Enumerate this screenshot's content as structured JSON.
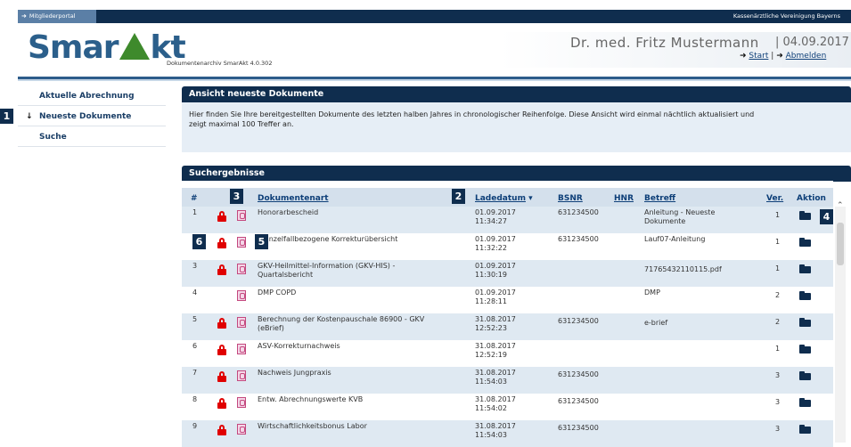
{
  "topbar": {
    "portal_label": "Mitgliederportal",
    "org_name": "Kassenärztliche Vereinigung Bayerns"
  },
  "header": {
    "logo_left": "Smar",
    "logo_right": "kt",
    "subtitle": "Dokumentenarchiv SmarAkt 4.0.302",
    "user_name": "Dr. med. Fritz Mustermann",
    "date": "| 04.09.2017",
    "start_label": "Start",
    "logout_label": "Abmelden"
  },
  "sidebar": {
    "items": [
      {
        "label": "Aktuelle Abrechnung"
      },
      {
        "label": "Neueste Dokumente",
        "mark": "↓"
      },
      {
        "label": "Suche"
      }
    ]
  },
  "badges": [
    "1",
    "2",
    "3",
    "4",
    "5",
    "6"
  ],
  "overview": {
    "title": "Ansicht neueste Dokumente",
    "text_line1": "Hier finden Sie Ihre bereitgestellten Dokumente des letzten halben Jahres in chronologischer Reihenfolge. Diese Ansicht wird einmal nächtlich aktualisiert und",
    "text_line2": "zeigt maximal 100 Treffer an."
  },
  "results": {
    "title": "Suchergebnisse",
    "columns": {
      "num": "#",
      "doctype": "Dokumentenart",
      "loaddate": "Ladedatum",
      "sort_arrow": "▾",
      "bsnr": "BSNR",
      "hnr": "HNR",
      "subject": "Betreff",
      "ver": "Ver.",
      "action": "Aktion"
    },
    "rows": [
      {
        "num": "1",
        "lock": true,
        "doctype": "Honorarbescheid",
        "doctype2": "",
        "date": "01.09.2017",
        "time": "11:34:27",
        "bsnr": "631234500",
        "subject": "Anleitung - Neueste",
        "subject2": "Dokumente",
        "ver": "1"
      },
      {
        "num": "2",
        "lock": true,
        "doctype": "- Einzelfallbezogene Korrekturübersicht",
        "doctype2": "",
        "date": "01.09.2017",
        "time": "11:32:22",
        "bsnr": "631234500",
        "subject": "Lauf07-Anleitung",
        "subject2": "",
        "ver": "1"
      },
      {
        "num": "3",
        "lock": true,
        "doctype": "GKV-Heilmittel-Information (GKV-HIS) -",
        "doctype2": "Quartalsbericht",
        "date": "01.09.2017",
        "time": "11:30:19",
        "bsnr": "",
        "subject": "71765432110115.pdf",
        "subject2": "",
        "ver": "1"
      },
      {
        "num": "4",
        "lock": false,
        "doctype": "DMP COPD",
        "doctype2": "",
        "date": "01.09.2017",
        "time": "11:28:11",
        "bsnr": "",
        "subject": "DMP",
        "subject2": "",
        "ver": "2"
      },
      {
        "num": "5",
        "lock": true,
        "doctype": "Berechnung der Kostenpauschale 86900 - GKV",
        "doctype2": "(eBrief)",
        "date": "31.08.2017",
        "time": "12:52:23",
        "bsnr": "631234500",
        "subject": "e-brief",
        "subject2": "",
        "ver": "2"
      },
      {
        "num": "6",
        "lock": true,
        "doctype": "ASV-Korrekturnachweis",
        "doctype2": "",
        "date": "31.08.2017",
        "time": "12:52:19",
        "bsnr": "",
        "subject": "",
        "subject2": "",
        "ver": "1"
      },
      {
        "num": "7",
        "lock": true,
        "doctype": "Nachweis Jungpraxis",
        "doctype2": "",
        "date": "31.08.2017",
        "time": "11:54:03",
        "bsnr": "631234500",
        "subject": "",
        "subject2": "",
        "ver": "3"
      },
      {
        "num": "8",
        "lock": true,
        "doctype": "Entw. Abrechnungswerte KVB",
        "doctype2": "",
        "date": "31.08.2017",
        "time": "11:54:02",
        "bsnr": "631234500",
        "subject": "",
        "subject2": "",
        "ver": "3"
      },
      {
        "num": "9",
        "lock": true,
        "doctype": "Wirtschaftlichkeitsbonus Labor",
        "doctype2": "",
        "date": "31.08.2017",
        "time": "11:54:03",
        "bsnr": "631234500",
        "subject": "",
        "subject2": "",
        "ver": "3"
      }
    ]
  }
}
